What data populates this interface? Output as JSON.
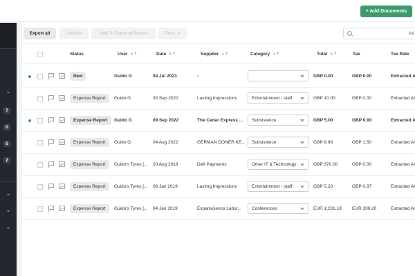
{
  "header": {
    "add_documents_label": "+ Add Documents"
  },
  "sidebar": {
    "badges": [
      "7",
      "0",
      "5",
      "2"
    ]
  },
  "toolbar": {
    "export_all": "Export all",
    "archive": "Archive",
    "add_to_expense_report": "Add To Expense Report",
    "tools": "Tools",
    "search_text": "Ad"
  },
  "table": {
    "columns": {
      "status": "Status",
      "user": "User",
      "date": "Date",
      "supplier": "Supplier",
      "category": "Category",
      "total": "Total",
      "tax": "Tax",
      "tax_rate": "Tax Rate"
    },
    "rows": [
      {
        "status": "New",
        "user": "Guido G",
        "date": "04 Jul 2023",
        "supplier": "-",
        "category": "",
        "total": "GBP 0.00",
        "tax": "GBP 0.00",
        "tax_rate": "Extracted Am",
        "bold": true,
        "dot": true
      },
      {
        "status": "Expense Report",
        "user": "Guido G",
        "date": "30 Sep 2022",
        "supplier": "Lasting Impressions",
        "category": "Entertainment - staff",
        "total": "GBP 10.00",
        "tax": "GBP 0.00",
        "tax_rate": "Extracted Am",
        "bold": false,
        "dot": false
      },
      {
        "status": "Expense Report",
        "user": "Guido G",
        "date": "09 Sep 2022",
        "supplier": "The Cedar Express ...",
        "category": "Subsistence",
        "total": "GBP 5.00",
        "tax": "GBP 0.00",
        "tax_rate": "Extracted Am",
        "bold": true,
        "dot": true
      },
      {
        "status": "Expense Report",
        "user": "Guido G",
        "date": "04 Aug 2022",
        "supplier": "GERMAN DONER KE...",
        "category": "Subsistence",
        "total": "GBP 8.98",
        "tax": "GBP 1.50",
        "tax_rate": "Extracted Am",
        "bold": false,
        "dot": false
      },
      {
        "status": "Expense Report",
        "user": "Guido's Tyres [...",
        "date": "20 Aug 2018",
        "supplier": "Deft Payments",
        "category": "Other IT & Technology",
        "total": "GBP 370.00",
        "tax": "GBP 0.00",
        "tax_rate": "Extracted Am",
        "bold": false,
        "dot": false
      },
      {
        "status": "Expense Report",
        "user": "Guido's Tyres [...",
        "date": "08 Jan 2019",
        "supplier": "Lasting Impressions",
        "category": "Entertainment - staff",
        "total": "GBP 5.20",
        "tax": "GBP 0.87",
        "tax_rate": "Extracted Am",
        "bold": false,
        "dot": false
      },
      {
        "status": "Expense Report",
        "user": "Guido's Tyres [...",
        "date": "04 Jan 2019",
        "supplier": "Expanscience Labor...",
        "category": "Conferences",
        "total": "EUR 1,201.18",
        "tax": "EUR 200.20",
        "tax_rate": "Extracted Am",
        "bold": false,
        "dot": false
      }
    ]
  },
  "colors": {
    "accent": "#3d9a6d",
    "sidebar": "#23282e"
  }
}
